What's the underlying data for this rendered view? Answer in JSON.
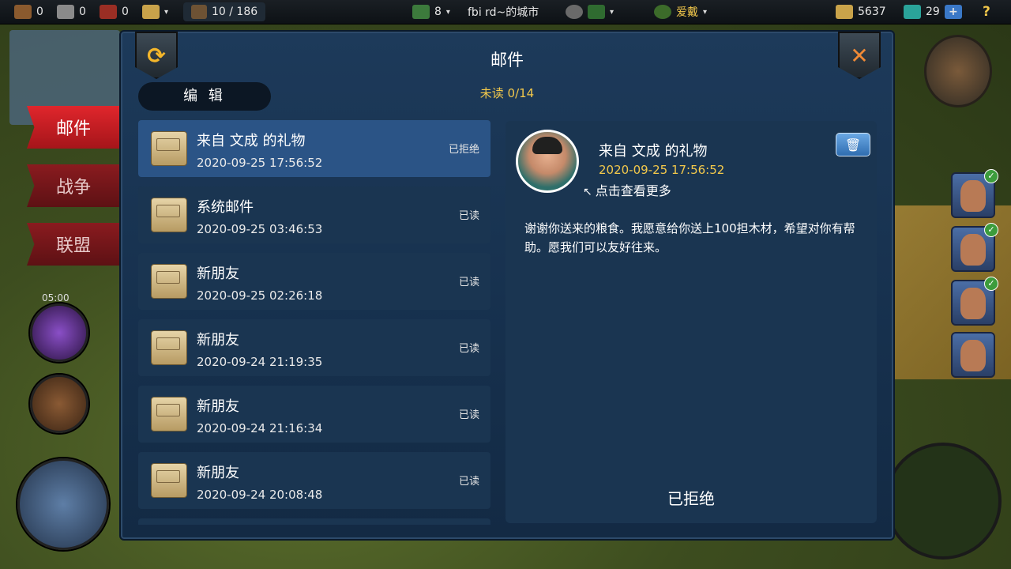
{
  "topbar": {
    "res1": "0",
    "res2": "0",
    "res3": "0",
    "population": "10 / 186",
    "level": "8",
    "city": "fbi rd~的城市",
    "title": "爱戴",
    "gold": "5637",
    "gems": "29",
    "plus": "+",
    "help": "?",
    "caret": "▾"
  },
  "side_tabs": [
    {
      "label": "邮件"
    },
    {
      "label": "战争"
    },
    {
      "label": "联盟"
    }
  ],
  "timer": "05:00",
  "dialog": {
    "title": "邮件",
    "unread": "未读 0/14",
    "edit_label": "编 辑",
    "refresh_glyph": "⟳",
    "close_glyph": "✕"
  },
  "mails": [
    {
      "subject": "来自 文成 的礼物",
      "date": "2020-09-25 17:56:52",
      "state": "已拒绝"
    },
    {
      "subject": "系统邮件",
      "date": "2020-09-25 03:46:53",
      "state": "已读"
    },
    {
      "subject": "新朋友",
      "date": "2020-09-25 02:26:18",
      "state": "已读"
    },
    {
      "subject": "新朋友",
      "date": "2020-09-24 21:19:35",
      "state": "已读"
    },
    {
      "subject": "新朋友",
      "date": "2020-09-24 21:16:34",
      "state": "已读"
    },
    {
      "subject": "新朋友",
      "date": "2020-09-24 20:08:48",
      "state": "已读"
    }
  ],
  "detail": {
    "subject": "来自 文成 的礼物",
    "date": "2020-09-25 17:56:52",
    "more": "点击查看更多",
    "body": "谢谢你送来的粮食。我愿意给你送上100担木材，希望对你有帮助。愿我们可以友好往来。",
    "status": "已拒绝",
    "trash_glyph": "🗑"
  },
  "portrait_check": "✓",
  "colors": {
    "accent_red": "#e0262c",
    "gold_text": "#f2c84b",
    "panel": "#1a3551",
    "selected": "#2b5486"
  }
}
